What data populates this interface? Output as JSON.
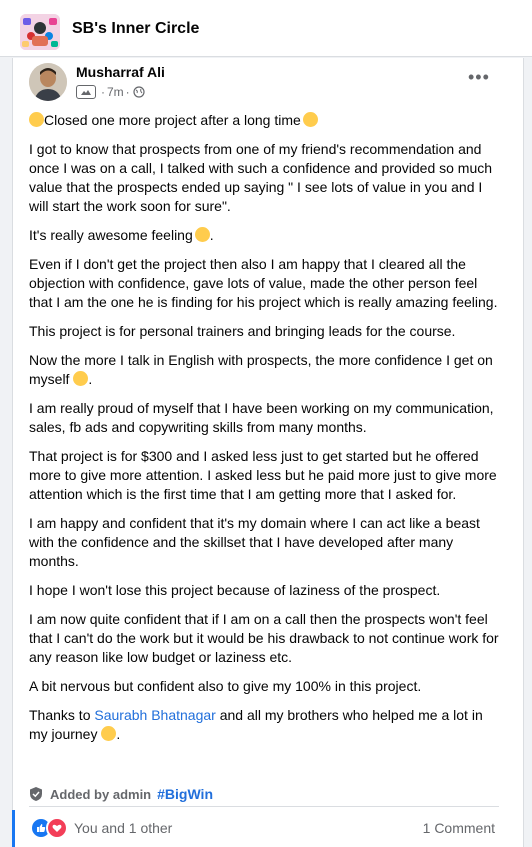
{
  "group": {
    "name": "SB's Inner Circle"
  },
  "post": {
    "author": "Musharraf Ali",
    "time": "7m",
    "paragraphs": [
      "Closed one more project after a long time",
      "I got to know that prospects from one of my friend's recommendation and once I was on a call, I talked with such a confidence and provided so much value that the prospects ended up saying \" I see lots of value in you and I will start the work soon for sure\".",
      "It's really awesome feeling",
      "Even if I don't get the project then also I am happy that I cleared all the objection with confidence, gave lots of value, made the other person feel that I am the one he is finding for his project which is really amazing feeling.",
      "This project is for personal trainers and bringing leads for the course.",
      "Now the more I talk in English with prospects, the more confidence I get on myself",
      "I am really proud of myself that I have been working on my communication, sales, fb ads and copywriting skills from many months.",
      "That project is for $300 and I asked less just to get started but he offered more to give more attention. I asked less but he paid more just to give more attention which is the first time that I am getting more that I asked for.",
      "I am happy and confident that it's my domain where I can act like a beast with the confidence and the skillset that I have developed after many months.",
      "I hope I won't lose this project because of laziness of the prospect.",
      "I am now quite confident that if I am on a call then the prospects won't feel that I can't do the work but it would be his drawback to not continue work for any reason like low budget or laziness etc.",
      "A bit nervous but confident also to give my 100% in this project."
    ],
    "thanks_prefix": "Thanks to ",
    "mention": "Saurabh Bhatnagar",
    "thanks_suffix": " and all my brothers who helped me a lot in my journey ",
    "added_by": "Added by admin",
    "hashtag": "#BigWin",
    "reactions_text": "You and 1 other",
    "comments_text": "1 Comment"
  },
  "icons": {
    "more": "more-options-icon",
    "privacy": "public-globe-icon",
    "admin": "admin-shield-icon",
    "like": "like-reaction-icon",
    "love": "love-reaction-icon"
  },
  "colors": {
    "link": "#216fdb",
    "like": "#1877f2",
    "love": "#f33e58"
  }
}
